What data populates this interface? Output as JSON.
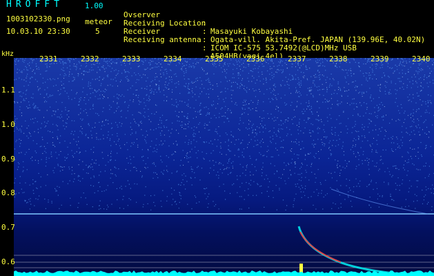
{
  "header": {
    "app_title": "HROFFT",
    "app_version": "1.00",
    "file_name": "1003102330.png",
    "datetime": "10.03.10 23:30",
    "mode_label": "meteor",
    "count_value": "5"
  },
  "info": [
    {
      "label": "Ovserver",
      "value": "Masayuki Kobayashi"
    },
    {
      "label": "Receiving Location",
      "value": "Ogata-vill. Akita-Pref. JAPAN (139.96E, 40.02N)"
    },
    {
      "label": "Receiver",
      "value": "ICOM IC-575 53.7492(@LCD)MHz USB"
    },
    {
      "label": "Receiving antenna",
      "value": "A504HB(yagi 4el)"
    }
  ],
  "axis": {
    "unit": "kHz",
    "time_ticks": [
      "2331",
      "2332",
      "2333",
      "2334",
      "2335",
      "2336",
      "2337",
      "2338",
      "2339",
      "2340"
    ],
    "freq_ticks": [
      "1.1",
      "1.0",
      "0.9",
      "0.8",
      "0.7",
      "0.6"
    ]
  },
  "colors": {
    "label_yellow": "#ffff40",
    "title_cyan": "#00ffff",
    "trace_cyan": "#00ffff",
    "echo_red": "#ff3030"
  }
}
